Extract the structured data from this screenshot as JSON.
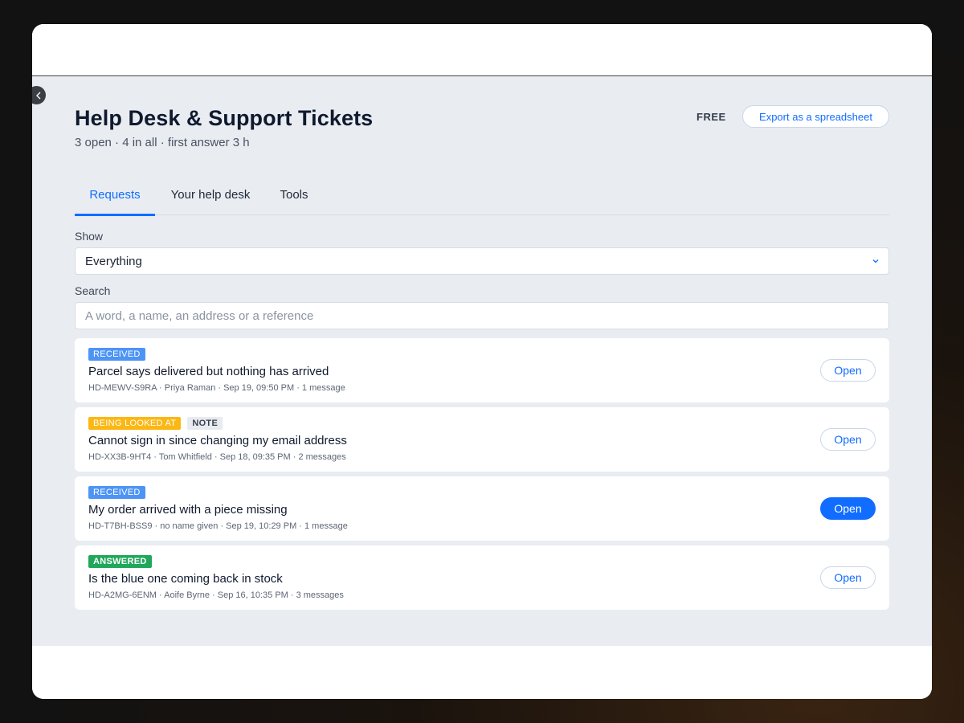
{
  "header": {
    "title": "Help Desk & Support Tickets",
    "subtitle": "3 open · 4 in all · first answer 3 h",
    "plan": "FREE",
    "export_label": "Export as a spreadsheet"
  },
  "tabs": [
    {
      "label": "Requests",
      "active": true
    },
    {
      "label": "Your help desk",
      "active": false
    },
    {
      "label": "Tools",
      "active": false
    }
  ],
  "filter": {
    "label": "Show",
    "value": "Everything"
  },
  "search": {
    "label": "Search",
    "placeholder": "A word, a name, an address or a reference",
    "value": ""
  },
  "tickets": [
    {
      "status": "RECEIVED",
      "note": "",
      "title": "Parcel says delivered but nothing has arrived",
      "meta": "HD-MEWV-S9RA · Priya Raman · Sep 19, 09:50 PM · 1 message",
      "action": "Open"
    },
    {
      "status": "BEING LOOKED AT",
      "note": "NOTE",
      "title": "Cannot sign in since changing my email address",
      "meta": "HD-XX3B-9HT4 · Tom Whitfield · Sep 18, 09:35 PM · 2 messages",
      "action": "Open"
    },
    {
      "status": "RECEIVED",
      "note": "",
      "title": "My order arrived with a piece missing",
      "meta": "HD-T7BH-BSS9 · no name given · Sep 19, 10:29 PM · 1 message",
      "action": "Open"
    },
    {
      "status": "ANSWERED",
      "note": "",
      "title": "Is the blue one coming back in stock",
      "meta": "HD-A2MG-6ENM · Aoife Byrne · Sep 16, 10:35 PM · 3 messages",
      "action": "Open"
    }
  ],
  "colors": {
    "accent": "#116dff",
    "received": "#4d94f5",
    "being_looked_at": "#fbb714",
    "answered": "#21a75b",
    "content_bg": "#e9edf2"
  },
  "icons": {
    "collapse": "chevron-left-icon",
    "dropdown": "chevron-down-icon"
  }
}
